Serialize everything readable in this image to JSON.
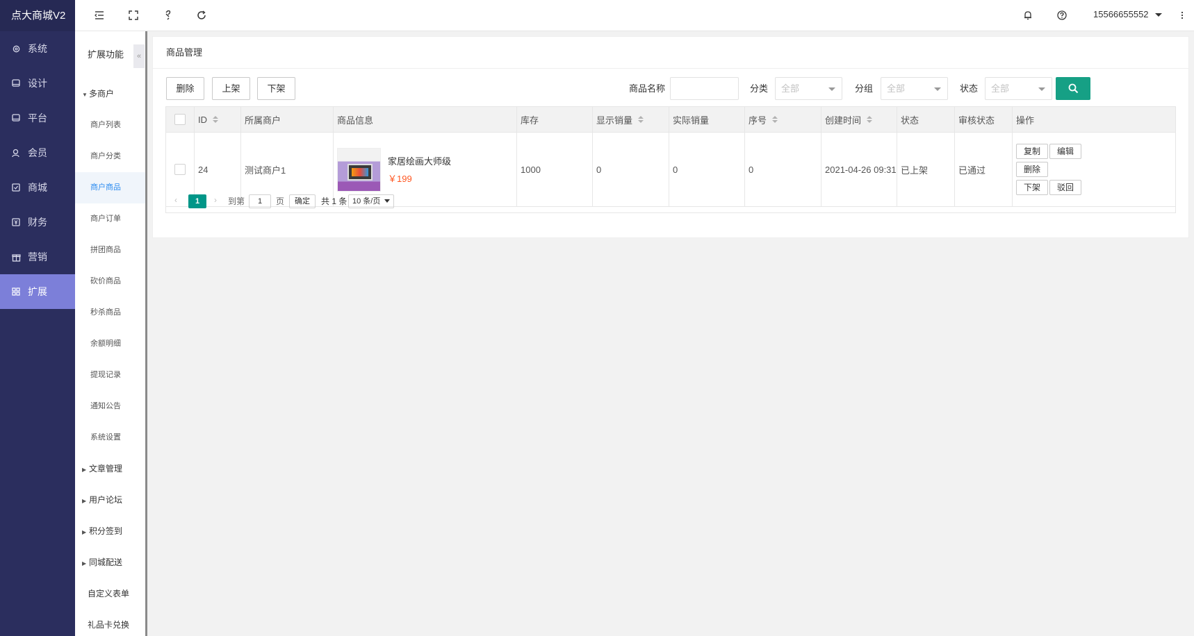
{
  "app": {
    "title": "点大商城V2"
  },
  "nav": [
    {
      "label": "系统",
      "icon": "gear-icon"
    },
    {
      "label": "设计",
      "icon": "monitor-icon"
    },
    {
      "label": "平台",
      "icon": "monitor-icon"
    },
    {
      "label": "会员",
      "icon": "user-icon"
    },
    {
      "label": "商城",
      "icon": "check-box-icon"
    },
    {
      "label": "财务",
      "icon": "finance-icon"
    },
    {
      "label": "营销",
      "icon": "gift-icon"
    },
    {
      "label": "扩展",
      "icon": "grid-icon",
      "active": true
    }
  ],
  "topbar": {
    "user": "15566655552",
    "tools": [
      "menu-fold-icon",
      "fullscreen-icon",
      "link-icon",
      "refresh-icon"
    ],
    "right_icons": [
      "bell-icon",
      "help-icon",
      "more-icon"
    ]
  },
  "subnav": {
    "title": "扩展功能",
    "groups": [
      {
        "label": "多商户",
        "expanded": true,
        "items": [
          "商户列表",
          "商户分类",
          "商户商品",
          "商户订单",
          "拼团商品",
          "砍价商品",
          "秒杀商品",
          "余额明细",
          "提现记录",
          "通知公告",
          "系统设置"
        ],
        "active": "商户商品"
      },
      {
        "label": "文章管理"
      },
      {
        "label": "用户论坛"
      },
      {
        "label": "积分签到"
      },
      {
        "label": "同城配送"
      }
    ],
    "plain": [
      "自定义表单",
      "礼品卡兑换"
    ]
  },
  "page": {
    "title": "商品管理",
    "actions": {
      "delete": "删除",
      "on_shelf": "上架",
      "off_shelf": "下架"
    },
    "filters": {
      "name_label": "商品名称",
      "name_value": "",
      "category_label": "分类",
      "category_value": "全部",
      "group_label": "分组",
      "group_value": "全部",
      "status_label": "状态",
      "status_value": "全部"
    }
  },
  "table": {
    "headers": [
      "ID",
      "所属商户",
      "商品信息",
      "库存",
      "显示销量",
      "实际销量",
      "序号",
      "创建时间",
      "状态",
      "审核状态",
      "操作"
    ],
    "rows": [
      {
        "id": "24",
        "merchant": "测试商户1",
        "name": "家居绘画大师级",
        "price": "￥199",
        "stock": "1000",
        "shown_sales": "0",
        "real_sales": "0",
        "sort": "0",
        "created": "2021-04-26 09:31",
        "status": "已上架",
        "review": "已通过",
        "ops": [
          "复制",
          "编辑",
          "删除",
          "下架",
          "驳回"
        ]
      }
    ]
  },
  "pager": {
    "current": "1",
    "goto_label": "到第",
    "goto_value": "1",
    "page_unit": "页",
    "confirm": "确定",
    "total": "共 1 条",
    "size": "10 条/页"
  },
  "colors": {
    "nav_bg": "#2b2e5e",
    "nav_active": "#7c7fd9",
    "primary": "#16a085",
    "pager_active": "#009688",
    "price": "#ff5722",
    "status_green": "#009900"
  }
}
